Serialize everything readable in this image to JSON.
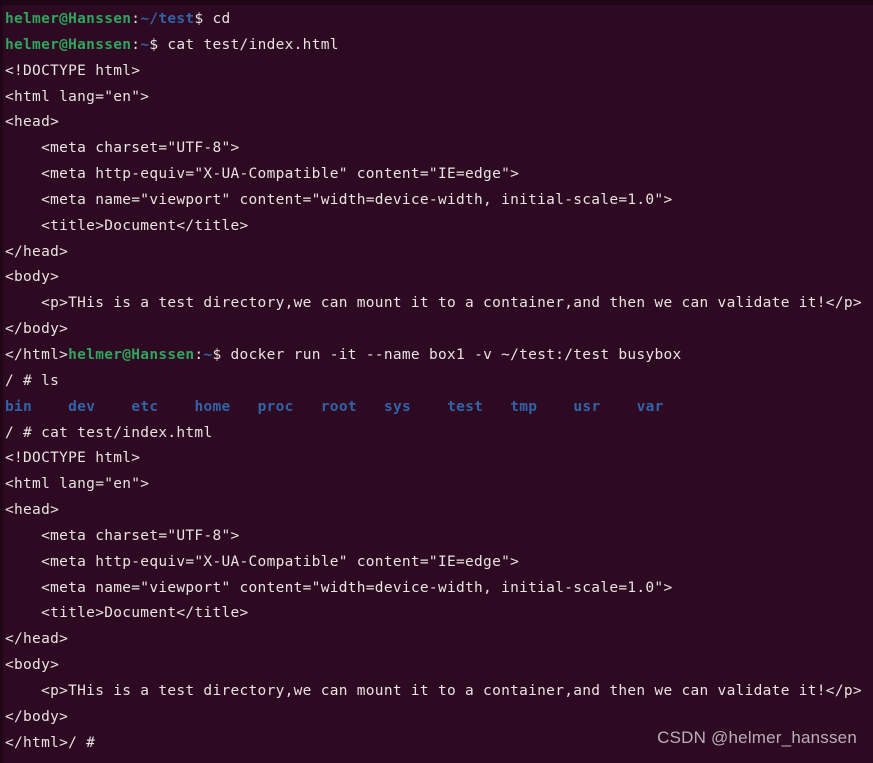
{
  "terminal": {
    "colors": {
      "background": "#2d0922",
      "border": "#1f0718",
      "foreground": "#e8e4e0",
      "prompt_user": "#2fa55e",
      "prompt_path": "#3163a8",
      "directory": "#3163a8",
      "watermark": "#b9b0b5"
    },
    "prompt": {
      "user_host": "helmer@Hanssen",
      "colon": ":",
      "path_test": "~/test",
      "path_home": "~",
      "sigil": "$ ",
      "container_prompt": "/ # "
    },
    "watermark": "CSDN @helmer_hanssen",
    "lines": [
      {
        "id": "l01",
        "type": "prompt",
        "path": "~/test",
        "command": "cd"
      },
      {
        "id": "l02",
        "type": "prompt",
        "path": "~",
        "command": "cat test/index.html"
      },
      {
        "id": "l03",
        "type": "output",
        "text": "<!DOCTYPE html>"
      },
      {
        "id": "l04",
        "type": "output",
        "text": "<html lang=\"en\">"
      },
      {
        "id": "l05",
        "type": "output",
        "text": "<head>"
      },
      {
        "id": "l06",
        "type": "output",
        "text": "    <meta charset=\"UTF-8\">"
      },
      {
        "id": "l07",
        "type": "output",
        "text": "    <meta http-equiv=\"X-UA-Compatible\" content=\"IE=edge\">"
      },
      {
        "id": "l08",
        "type": "output",
        "text": "    <meta name=\"viewport\" content=\"width=device-width, initial-scale=1.0\">"
      },
      {
        "id": "l09",
        "type": "output",
        "text": "    <title>Document</title>"
      },
      {
        "id": "l10",
        "type": "output",
        "text": "</head>"
      },
      {
        "id": "l11",
        "type": "output",
        "text": "<body>"
      },
      {
        "id": "l12",
        "type": "output",
        "text": "    <p>THis is a test directory,we can mount it to a container,and then we can validate it!</p>"
      },
      {
        "id": "l13",
        "type": "output",
        "text": "</body>"
      },
      {
        "id": "l14",
        "type": "output_then_prompt",
        "leading": "</html>",
        "path": "~",
        "command": "docker run -it --name box1 -v ~/test:/test busybox"
      },
      {
        "id": "l15",
        "type": "container_prompt",
        "command": "ls"
      },
      {
        "id": "l16",
        "type": "dirlist",
        "entries": [
          "bin",
          "dev",
          "etc",
          "home",
          "proc",
          "root",
          "sys",
          "test",
          "tmp",
          "usr",
          "var"
        ]
      },
      {
        "id": "l17",
        "type": "container_prompt",
        "command": "cat test/index.html"
      },
      {
        "id": "l18",
        "type": "output",
        "text": "<!DOCTYPE html>"
      },
      {
        "id": "l19",
        "type": "output",
        "text": "<html lang=\"en\">"
      },
      {
        "id": "l20",
        "type": "output",
        "text": "<head>"
      },
      {
        "id": "l21",
        "type": "output",
        "text": "    <meta charset=\"UTF-8\">"
      },
      {
        "id": "l22",
        "type": "output",
        "text": "    <meta http-equiv=\"X-UA-Compatible\" content=\"IE=edge\">"
      },
      {
        "id": "l23",
        "type": "output",
        "text": "    <meta name=\"viewport\" content=\"width=device-width, initial-scale=1.0\">"
      },
      {
        "id": "l24",
        "type": "output",
        "text": "    <title>Document</title>"
      },
      {
        "id": "l25",
        "type": "output",
        "text": "</head>"
      },
      {
        "id": "l26",
        "type": "output",
        "text": "<body>"
      },
      {
        "id": "l27",
        "type": "output",
        "text": "    <p>THis is a test directory,we can mount it to a container,and then we can validate it!</p>"
      },
      {
        "id": "l28",
        "type": "output",
        "text": "</body>"
      },
      {
        "id": "l29",
        "type": "output_then_container_prompt",
        "leading": "</html>",
        "command": ""
      }
    ]
  }
}
